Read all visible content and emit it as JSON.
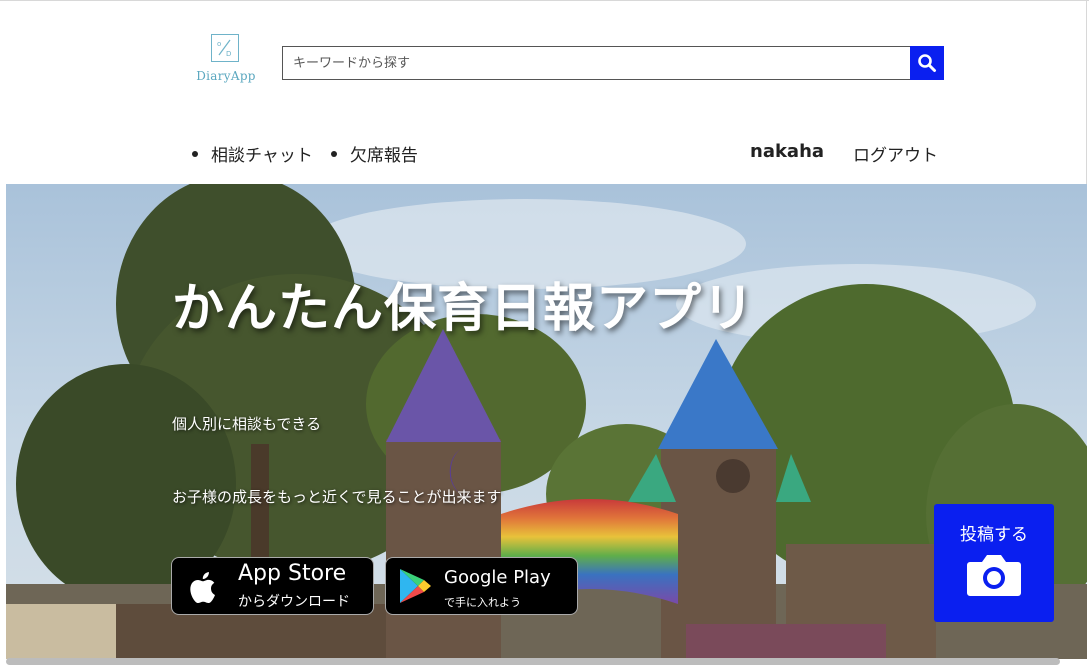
{
  "header": {
    "logo_text": "DiaryApp",
    "search": {
      "placeholder": "キーワードから探す",
      "value": ""
    }
  },
  "nav": {
    "items": [
      {
        "label": "相談チャット"
      },
      {
        "label": "欠席報告"
      }
    ],
    "username": "nakaha",
    "logout_label": "ログアウト"
  },
  "hero": {
    "title": "かんたん保育日報アプリ",
    "line1": "個人別に相談もできる",
    "line2": "お子様の成長をもっと近くで見ることが出来ます"
  },
  "badges": {
    "app_store": {
      "main": "App Store",
      "sub": "からダウンロード"
    },
    "google_play": {
      "main": "Google Play",
      "sub": "で手に入れよう"
    }
  },
  "post_button": {
    "label": "投稿する"
  },
  "colors": {
    "accent": "#0a1ff0",
    "logo": "#5aa7bf"
  }
}
